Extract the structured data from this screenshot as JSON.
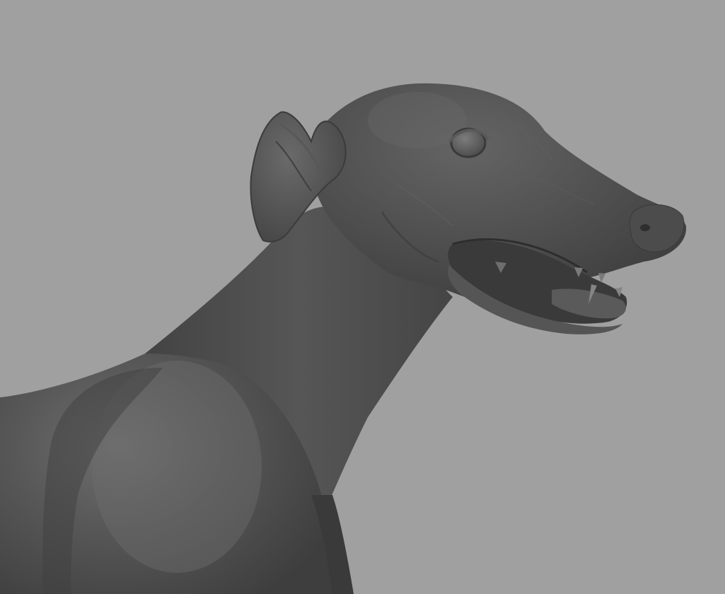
{
  "viewport": {
    "background_color": "#a0a0a0",
    "subject": "sculpted-dog-model-icon",
    "model_color": "#4b4b4b"
  }
}
